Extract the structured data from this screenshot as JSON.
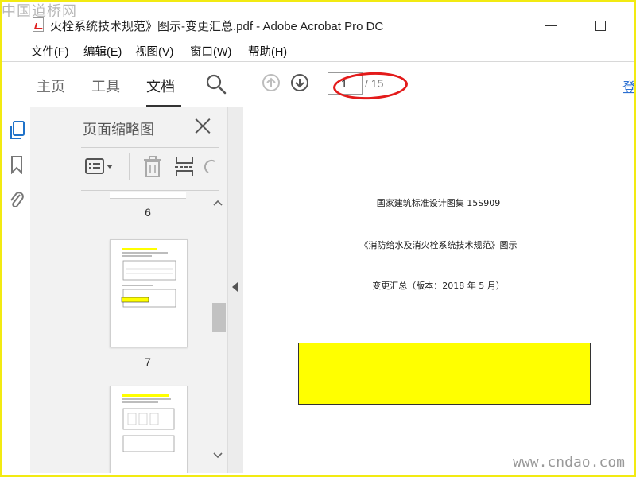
{
  "watermarks": {
    "top": "中国道桥网",
    "bottom": "www.cndao.com"
  },
  "titlebar": {
    "title": "火栓系统技术规范》图示-变更汇总.pdf - Adobe Acrobat Pro DC",
    "minimize": "—"
  },
  "menu": {
    "items": [
      "文件(F)",
      "编辑(E)",
      "视图(V)",
      "窗口(W)",
      "帮助(H)"
    ]
  },
  "toolbar": {
    "tabs": [
      "主页",
      "工具",
      "文档"
    ],
    "active_tab": "文档",
    "page_current": "1",
    "page_total": "/ 15",
    "login_partial": "登"
  },
  "thumbnail_panel": {
    "title": "页面缩略图",
    "pages": [
      {
        "label": "6"
      },
      {
        "label": "7"
      }
    ]
  },
  "document": {
    "line1": "国家建筑标准设计图集 15S909",
    "line2": "《消防给水及消火栓系统技术规范》图示",
    "line3": "变更汇总（版本：2018 年 5 月）"
  },
  "colors": {
    "frame": "#f2ea12",
    "annotation_red": "#e31b1b",
    "highlight_yellow": "#ffff00",
    "link_blue": "#2b6fd1"
  }
}
